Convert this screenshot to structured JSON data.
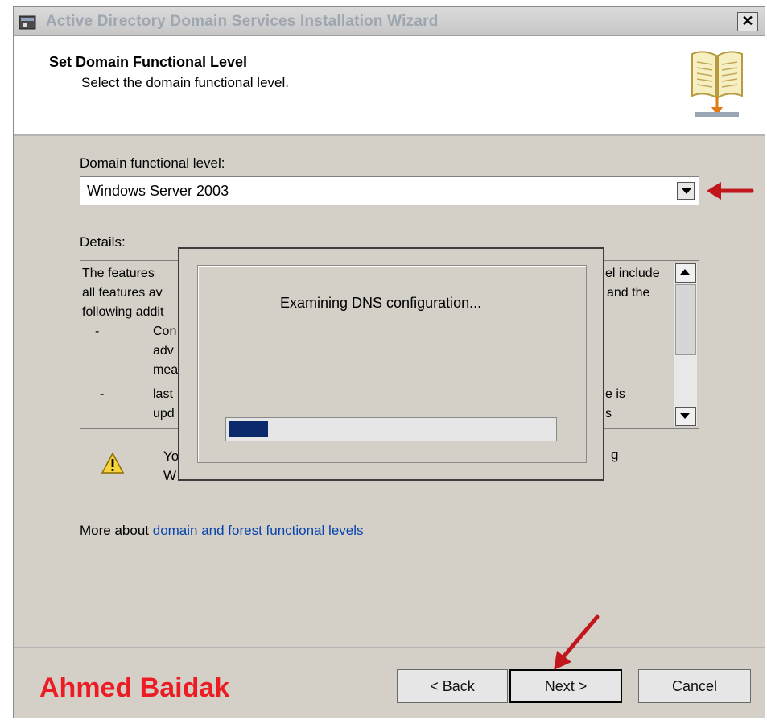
{
  "window": {
    "title": "Active Directory Domain Services Installation Wizard",
    "close_label": "✕"
  },
  "header": {
    "title": "Set Domain Functional Level",
    "subtitle": "Select the domain functional level."
  },
  "domain_level": {
    "label": "Domain functional level:",
    "selected": "Windows Server 2003"
  },
  "details": {
    "label": "Details:",
    "lines": [
      "The features",
      "all features av",
      "following addit",
      "Con",
      "adv",
      "mea",
      "last",
      "upd",
      "el include",
      "and the",
      "e is",
      "s"
    ],
    "bullets": [
      "-",
      "-"
    ]
  },
  "warning": {
    "icon": "warning-icon",
    "line1": "Yo",
    "line2": "W",
    "line1_right": "g"
  },
  "more_about": {
    "prefix": "More about",
    "link": "domain and forest functional levels"
  },
  "buttons": {
    "back": "< Back",
    "next": "Next >",
    "cancel": "Cancel"
  },
  "watermark": "Ahmed Baidak",
  "progress_dialog": {
    "message": "Examining DNS configuration...",
    "progress": 0.12
  },
  "colors": {
    "annotation_arrow": "#c0161c",
    "watermark": "#ec1c24",
    "progress_fill": "#0a2a6b",
    "link": "#0645ad"
  }
}
